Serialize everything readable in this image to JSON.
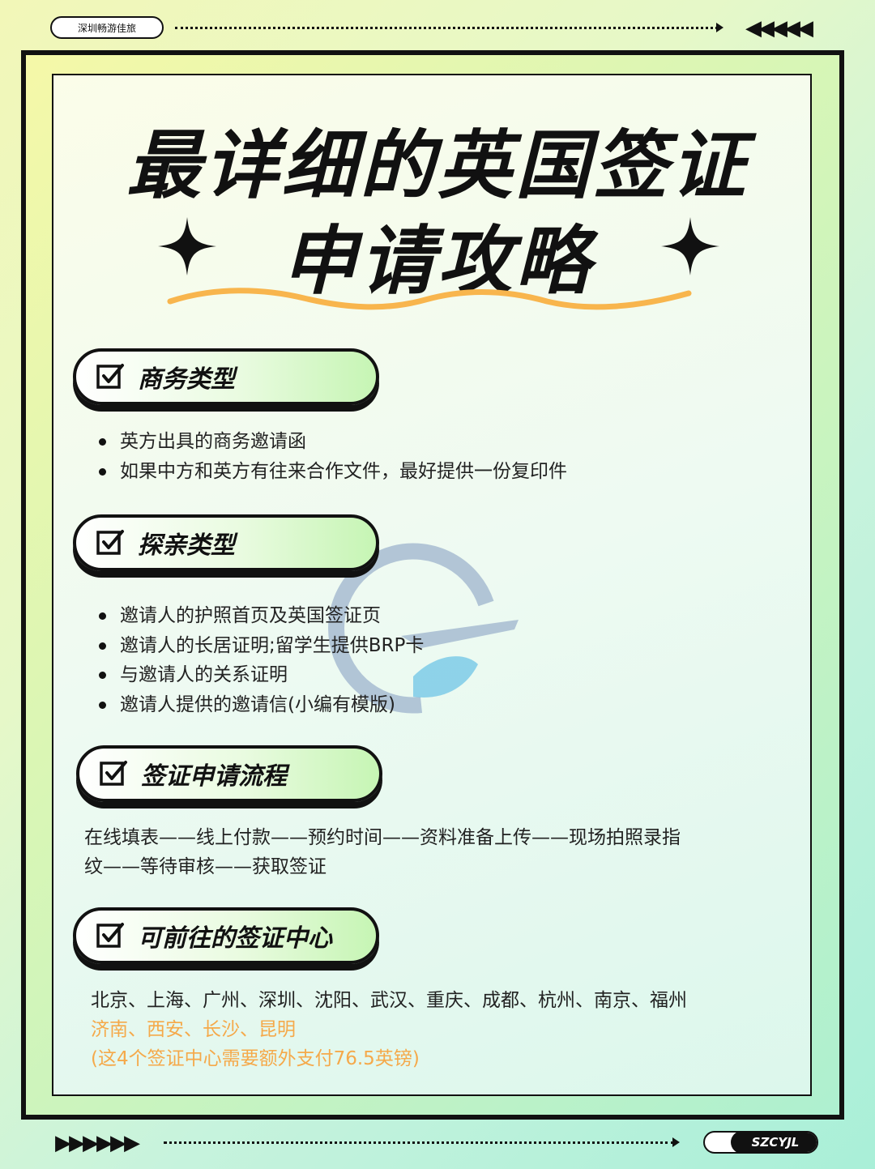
{
  "top_tag": "深圳畅游佳旅",
  "top_chevrons": "◀◀◀◀◀",
  "title": {
    "line1": "最详细的英国签证",
    "line2": "申请攻略"
  },
  "sections": [
    {
      "heading": "商务类型",
      "items": [
        "英方出具的商务邀请函",
        "如果中方和英方有往来合作文件，最好提供一份复印件"
      ]
    },
    {
      "heading": "探亲类型",
      "items": [
        "邀请人的护照首页及英国签证页",
        "邀请人的长居证明;留学生提供BRP卡",
        "与邀请人的关系证明",
        "邀请人提供的邀请信(小编有模版)"
      ]
    },
    {
      "heading": "签证申请流程",
      "text_line1": "在线填表——线上付款——预约时间——资料准备上传——现场拍照录指",
      "text_line2": "纹——等待审核——获取签证"
    },
    {
      "heading": "可前往的签证中心",
      "text_line1": "北京、上海、广州、深圳、沈阳、武汉、重庆、成都、杭州、南京、福州",
      "text_line2": "济南、西安、长沙、昆明",
      "text_line3": "(这4个签证中心需要额外支付76.5英镑)"
    }
  ],
  "bottom_arrows": "▶▶▶▶▶▶",
  "bottom_tag": "SZCYJL",
  "colors": {
    "accent_orange": "#f5a94a",
    "mint": "#aef0d0",
    "lime": "#f5f8a8"
  }
}
